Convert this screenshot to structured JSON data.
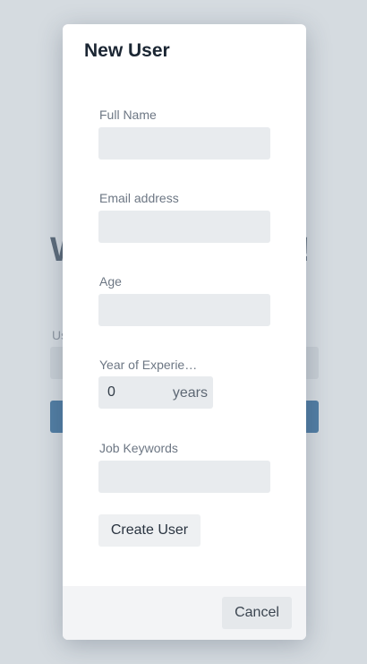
{
  "background": {
    "heading_left": "W",
    "heading_right": "!",
    "field_label_fragment": "Us"
  },
  "modal": {
    "title": "New User",
    "fields": [
      {
        "label": "Full Name",
        "value": ""
      },
      {
        "label": "Email address",
        "value": ""
      },
      {
        "label": "Age",
        "value": ""
      },
      {
        "label": "Year of Experie…",
        "value": "0",
        "unit": "years"
      },
      {
        "label": "Job Keywords",
        "value": ""
      }
    ],
    "create_label": "Create User",
    "cancel_label": "Cancel"
  },
  "colors": {
    "backdrop": "#d8dde2",
    "primary": "#0f4f86",
    "input_bg": "#e8ebee",
    "footer_bg": "#f3f4f6"
  }
}
